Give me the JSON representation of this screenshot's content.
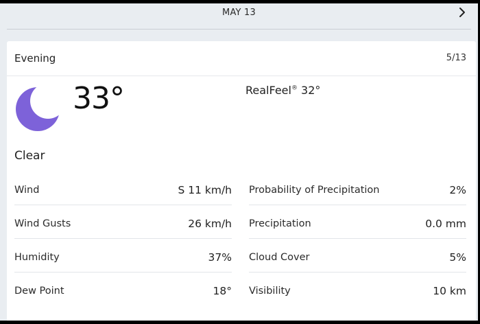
{
  "header": {
    "date": "MAY 13",
    "next_icon": "chevron-right-icon"
  },
  "card": {
    "period": "Evening",
    "page_count": "5/13",
    "weather_icon": "moon-icon",
    "moon_color": "#7d62d9",
    "temperature": "33°",
    "realfeel_label": "RealFeel",
    "realfeel_mark": "®",
    "realfeel_value": " 32°",
    "condition": "Clear"
  },
  "details": {
    "left": [
      {
        "label": "Wind",
        "value": "S 11 km/h"
      },
      {
        "label": "Wind Gusts",
        "value": "26 km/h"
      },
      {
        "label": "Humidity",
        "value": "37%"
      },
      {
        "label": "Dew Point",
        "value": "18°"
      }
    ],
    "right": [
      {
        "label": "Probability of Precipitation",
        "value": "2%"
      },
      {
        "label": "Precipitation",
        "value": "0.0 mm"
      },
      {
        "label": "Cloud Cover",
        "value": "5%"
      },
      {
        "label": "Visibility",
        "value": "10 km"
      }
    ]
  }
}
